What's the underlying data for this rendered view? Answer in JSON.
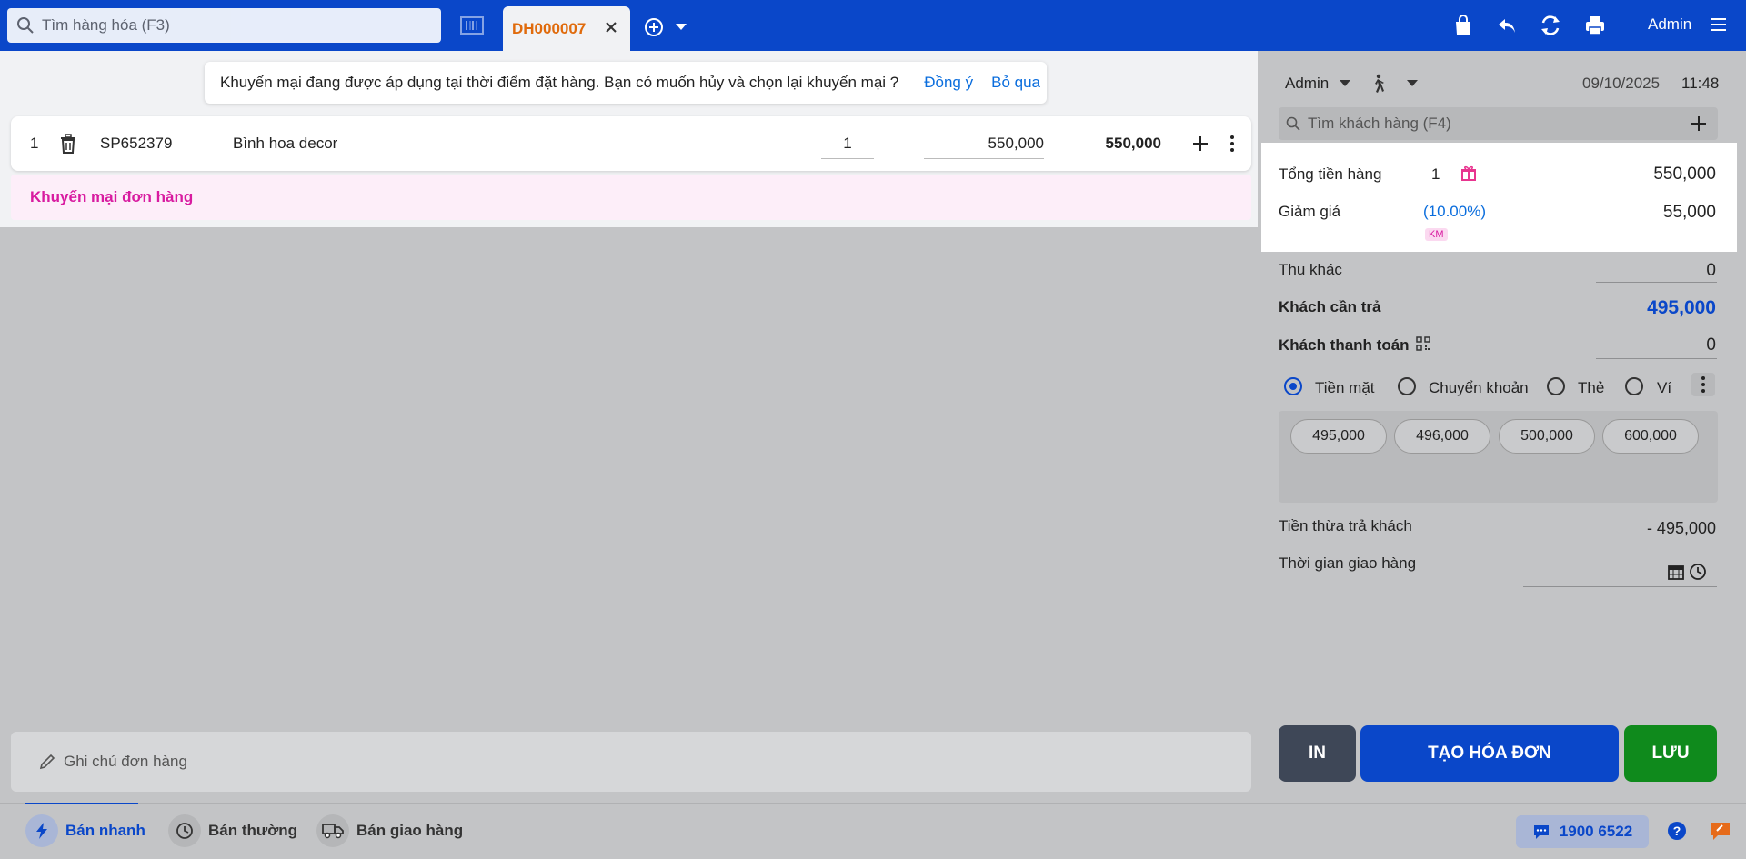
{
  "topbar": {
    "search_placeholder": "Tìm hàng hóa (F3)",
    "order_tab": "DH000007",
    "user": "Admin",
    "icons": [
      "search-icon",
      "barcode-icon",
      "close-icon",
      "add-circle-icon",
      "chevron-down-icon",
      "bag-icon",
      "return-icon",
      "swap-icon",
      "printer-icon",
      "menu-icon"
    ]
  },
  "notice": {
    "message": "Khuyến mại đang được áp dụng tại thời điểm đặt hàng. Bạn có muốn hủy và chọn lại khuyến mại ?",
    "agree": "Đồng ý",
    "skip": "Bỏ qua"
  },
  "items": [
    {
      "index": "1",
      "code": "SP652379",
      "name": "Bình hoa decor",
      "qty": "1",
      "price": "550,000",
      "total": "550,000"
    }
  ],
  "order_promo": "Khuyến mại đơn hàng",
  "note_placeholder": "Ghi chú đơn hàng",
  "right": {
    "seller": "Admin",
    "date": "09/10/2025",
    "time": "11:48",
    "customer_search": "Tìm khách hàng (F4)",
    "subtotal_label": "Tổng tiền hàng",
    "subtotal_count": "1",
    "subtotal_value": "550,000",
    "discount_label": "Giảm giá",
    "discount_pct": "(10.00%)",
    "discount_badge": "KM",
    "discount_value": "55,000",
    "other_label": "Thu khác",
    "other_value": "0",
    "due_label": "Khách cần trả",
    "due_value": "495,000",
    "paid_label": "Khách thanh toán",
    "paid_value": "0",
    "methods": [
      "Tiền mặt",
      "Chuyển khoản",
      "Thẻ",
      "Ví"
    ],
    "selected_method": "Tiền mặt",
    "quick_amounts": [
      "495,000",
      "496,000",
      "500,000",
      "600,000"
    ],
    "change_label": "Tiền thừa trả khách",
    "change_value": "- 495,000",
    "delivery_label": "Thời gian giao hàng",
    "btn_print": "IN",
    "btn_create": "TẠO HÓA ĐƠN",
    "btn_save": "LƯU"
  },
  "bottombar": {
    "modes": [
      "Bán nhanh",
      "Bán thường",
      "Bán giao hàng"
    ],
    "active_mode": "Bán nhanh",
    "hotline": "1900 6522"
  },
  "colors": {
    "primary": "#0a47c9",
    "order_tab_text": "#e06b0c",
    "promo_pink": "#d81ba0",
    "save_green": "#0f8a1c",
    "print_dark": "#3e4757"
  }
}
